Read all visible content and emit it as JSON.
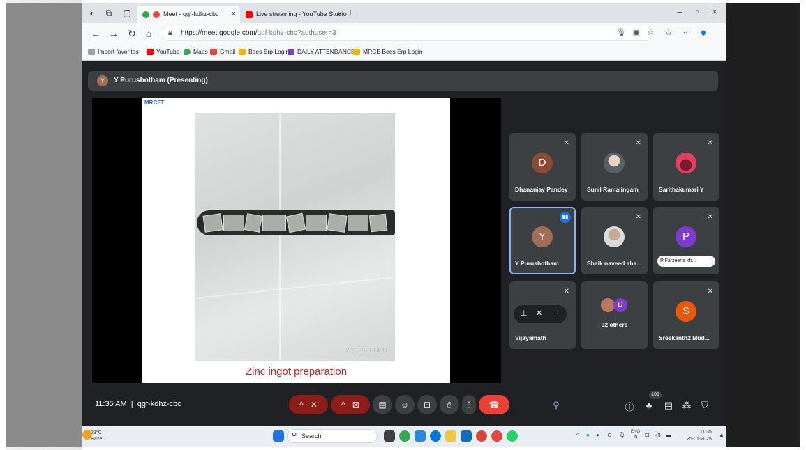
{
  "browser": {
    "tabs": [
      {
        "title": "Meet - qgf-kdhz-cbc",
        "active": true,
        "favicon_color": "#e8453c"
      },
      {
        "title": "Live streaming - YouTube Studio",
        "active": false,
        "favicon_color": "#ff0000"
      }
    ],
    "new_tab_label": "+",
    "url_host": "https://meet.google.com/",
    "url_path": "qgf-kdhz-cbc?authuser=3",
    "bookmarks": [
      {
        "label": "Import favorites",
        "icon": "folder-icon",
        "color": "#6b7280"
      },
      {
        "label": "YouTube",
        "icon": "youtube-icon",
        "color": "#ff0000"
      },
      {
        "label": "Maps",
        "icon": "maps-icon",
        "color": "#34a853"
      },
      {
        "label": "Gmail",
        "icon": "gmail-icon",
        "color": "#ea4335"
      },
      {
        "label": "Bees Erp Login",
        "icon": "bees-icon",
        "color": "#f4b400"
      },
      {
        "label": "DAILY ATTENDANCE...",
        "icon": "forms-icon",
        "color": "#7b3fc4"
      },
      {
        "label": "MRCE Bees Erp Login",
        "icon": "bees-icon",
        "color": "#f4b400"
      }
    ]
  },
  "meet": {
    "presenter_initial": "Y",
    "presenter_label": "Y Purushotham (Presenting)",
    "slide": {
      "logo_text": "MRCET",
      "photo_stamp": "2016-5-8 14:11",
      "caption": "Zinc ingot preparation"
    },
    "participants": [
      {
        "name": "Dhananjay Pandey",
        "initial": "D",
        "avatar_color": "#8d4a35",
        "muted": true
      },
      {
        "name": "Sunil Ramalingam",
        "initial": "",
        "avatar_color": "#9aa0a6",
        "muted": true
      },
      {
        "name": "Sarithakumari Y",
        "initial": "",
        "avatar_color": "#e2405e",
        "muted": true
      },
      {
        "name": "Y Purushotham",
        "initial": "Y",
        "avatar_color": "#a36c55",
        "muted": false,
        "speaking": true
      },
      {
        "name": "Shaik naveed aha...",
        "initial": "",
        "avatar_color": "#b5b9bd",
        "muted": true
      },
      {
        "name": "P Farzeena kh...",
        "initial": "P",
        "avatar_color": "#7e3bcf",
        "muted": true
      },
      {
        "name": "Vijayamath",
        "initial": "",
        "avatar_color": "#3c4043",
        "muted": true
      },
      {
        "name": "92 others",
        "initial": "D",
        "avatar_color": "#7e3bcf",
        "muted": false
      },
      {
        "name": "Sreekanth2 Mud...",
        "initial": "S",
        "avatar_color": "#e8590c",
        "muted": true
      }
    ],
    "time": "11:35 AM",
    "meeting_code": "qgf-kdhz-cbc",
    "people_count": "101"
  },
  "taskbar": {
    "temperature": "23°C",
    "weather": "Haze",
    "search_placeholder": "Search",
    "language": "ENG",
    "region": "IN",
    "clock_time": "11:35",
    "clock_date": "25-01-2025"
  }
}
